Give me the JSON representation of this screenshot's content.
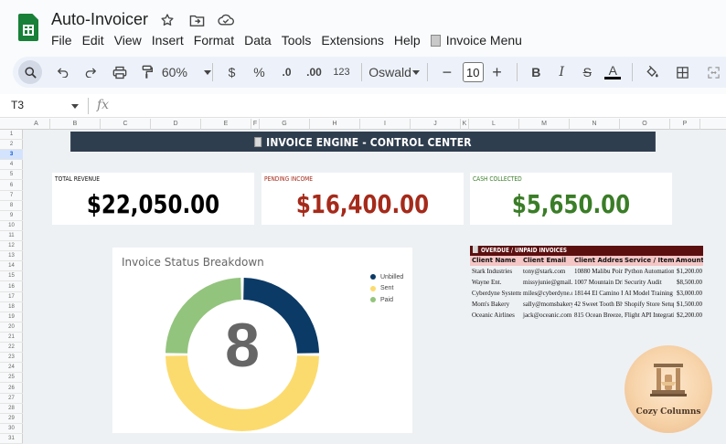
{
  "app": {
    "title": "Auto-Invoicer",
    "menu": [
      "File",
      "Edit",
      "View",
      "Insert",
      "Format",
      "Data",
      "Tools",
      "Extensions",
      "Help"
    ],
    "custom_menu": "Invoice Menu"
  },
  "toolbar": {
    "zoom": "60%",
    "currency": "$",
    "percent": "%",
    "dec_decrease": ".0",
    "dec_increase": ".00",
    "number_format": "123",
    "font": "Oswald",
    "font_size": "10",
    "bold": "B",
    "italic": "I",
    "strike": "S",
    "text_color_glyph": "A"
  },
  "formula_bar": {
    "cell_ref": "T3",
    "fx": "fx",
    "value": ""
  },
  "grid": {
    "columns": [
      "A",
      "B",
      "C",
      "D",
      "E",
      "F",
      "G",
      "H",
      "I",
      "J",
      "K",
      "L",
      "M",
      "N",
      "O",
      "P"
    ],
    "rows": [
      "1",
      "2",
      "3",
      "4",
      "5",
      "6",
      "7",
      "8",
      "9",
      "10",
      "11",
      "12",
      "13",
      "14",
      "15",
      "16",
      "17",
      "18",
      "19",
      "20",
      "21",
      "22",
      "23",
      "24",
      "25",
      "26",
      "27",
      "28",
      "29",
      "30",
      "31"
    ],
    "selected_row": "3"
  },
  "dashboard": {
    "banner": "INVOICE ENGINE - CONTROL CENTER",
    "cards": [
      {
        "label": "TOTAL REVENUE",
        "value": "$22,050.00",
        "color": "#000000"
      },
      {
        "label": "PENDING INCOME",
        "value": "$16,400.00",
        "color": "#a52a1a"
      },
      {
        "label": "CASH COLLECTED",
        "value": "$5,650.00",
        "color": "#3a7d27"
      }
    ],
    "chart_title": "Invoice Status Breakdown",
    "center_count": "8"
  },
  "chart_data": {
    "type": "pie",
    "title": "Invoice Status Breakdown",
    "donut": true,
    "center_label": "8",
    "legend_position": "right",
    "series": [
      {
        "name": "Unbilled",
        "value": 2,
        "color": "#0b3a66"
      },
      {
        "name": "Sent",
        "value": 4,
        "color": "#fcdb6e"
      },
      {
        "name": "Paid",
        "value": 2,
        "color": "#93c47d"
      }
    ]
  },
  "overdue": {
    "title": "OVERDUE / UNPAID INVOICES",
    "headers": [
      "Client Name",
      "Client Email",
      "Client Address",
      "Service / Item",
      "Amount ($)"
    ],
    "rows": [
      [
        "Stark Industries",
        "tony@stark.com",
        "10880 Malibu Point,",
        "Python Automation S",
        "$1,200.00"
      ],
      [
        "Wayne Ent.",
        "missyjunie@gmail.c",
        "1007 Mountain Drive",
        "Security Audit",
        "$8,500.00"
      ],
      [
        "Cyberdyne Systems",
        "miles@cyberdyne.co",
        "18144 El Camino Re:",
        "AI Model Training",
        "$3,000.00"
      ],
      [
        "Mom's Bakery",
        "sally@momsbakery.",
        "42 Sweet Tooth Blvd",
        "Shopify Store Setup",
        "$1,500.00"
      ],
      [
        "Oceanic Airlines",
        "jack@oceanic.com",
        "815 Ocean Breeze, S",
        "Flight API Integratio",
        "$2,200.00"
      ]
    ]
  },
  "badge": {
    "text": "Cozy Columns"
  },
  "icons": {
    "star": "star-icon",
    "move": "move-to-folder-icon",
    "cloud": "cloud-status-icon",
    "search": "search-icon",
    "undo": "undo-icon",
    "redo": "redo-icon",
    "print": "print-icon",
    "paint": "paint-format-icon",
    "fill": "fill-color-icon",
    "borders": "borders-icon",
    "merge": "merge-cells-icon"
  }
}
